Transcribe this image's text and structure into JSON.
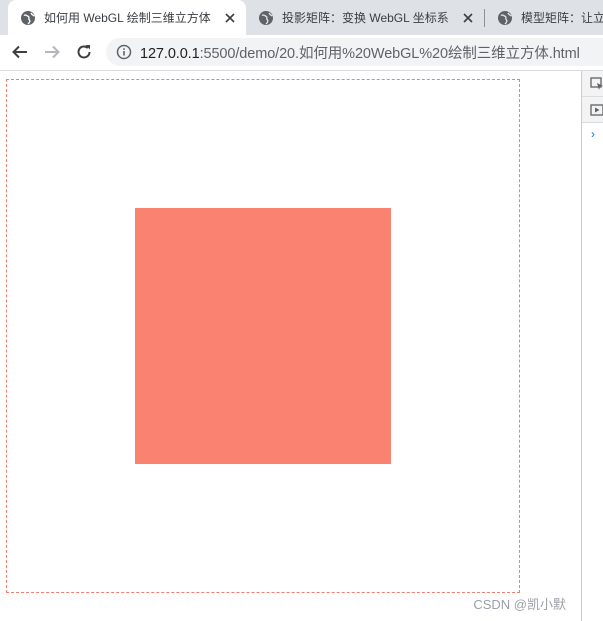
{
  "tabs": [
    {
      "title": "如何用 WebGL 绘制三维立方体",
      "active": true
    },
    {
      "title": "投影矩阵：变换 WebGL 坐标系",
      "active": false
    },
    {
      "title": "模型矩阵：让立",
      "active": false
    }
  ],
  "toolbar": {
    "url_host": "127.0.0.1",
    "url_path": ":5500/demo/20.如何用%20WebGL%20绘制三维立方体.html"
  },
  "page": {
    "square_color": "#fa8270",
    "canvas_border_color": "#f08070"
  },
  "watermark": "CSDN @凯小默",
  "icons": {
    "tab": "globe-icon",
    "close": "close-icon",
    "back": "back-arrow-icon",
    "forward": "forward-arrow-icon",
    "reload": "reload-icon",
    "info": "info-icon"
  }
}
